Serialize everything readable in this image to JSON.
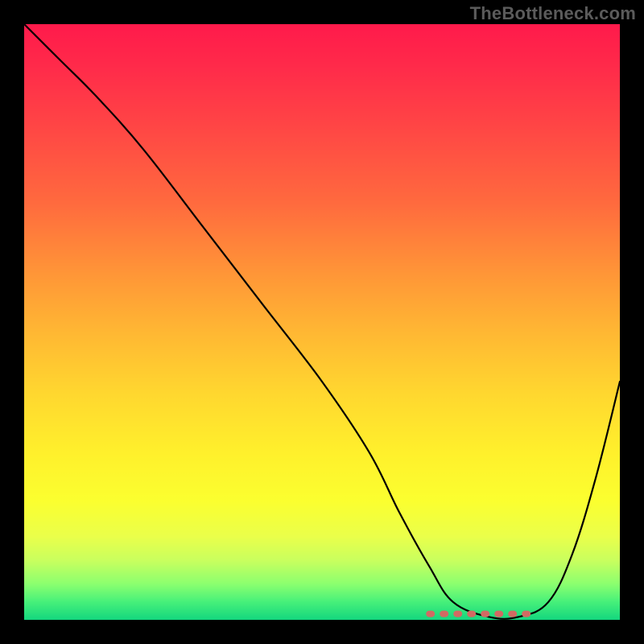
{
  "watermark": "TheBottleneck.com",
  "chart_data": {
    "type": "line",
    "title": "",
    "xlabel": "",
    "ylabel": "",
    "xlim": [
      0,
      100
    ],
    "ylim": [
      0,
      100
    ],
    "grid": false,
    "legend": false,
    "background": "red-yellow-green vertical gradient",
    "series": [
      {
        "name": "bottleneck-curve",
        "color": "#000000",
        "x": [
          0,
          6,
          12,
          20,
          30,
          40,
          50,
          58,
          63,
          68,
          72,
          78,
          83,
          88,
          92,
          96,
          100
        ],
        "y": [
          100,
          94,
          88,
          79,
          66,
          53,
          40,
          28,
          18,
          9,
          3,
          0.5,
          0.5,
          3,
          11,
          24,
          40
        ]
      }
    ],
    "annotations": [
      {
        "name": "optimal-range-marker",
        "type": "dotted-segment",
        "color": "#d16a63",
        "x_start": 68,
        "x_end": 86,
        "y": 1
      }
    ]
  }
}
